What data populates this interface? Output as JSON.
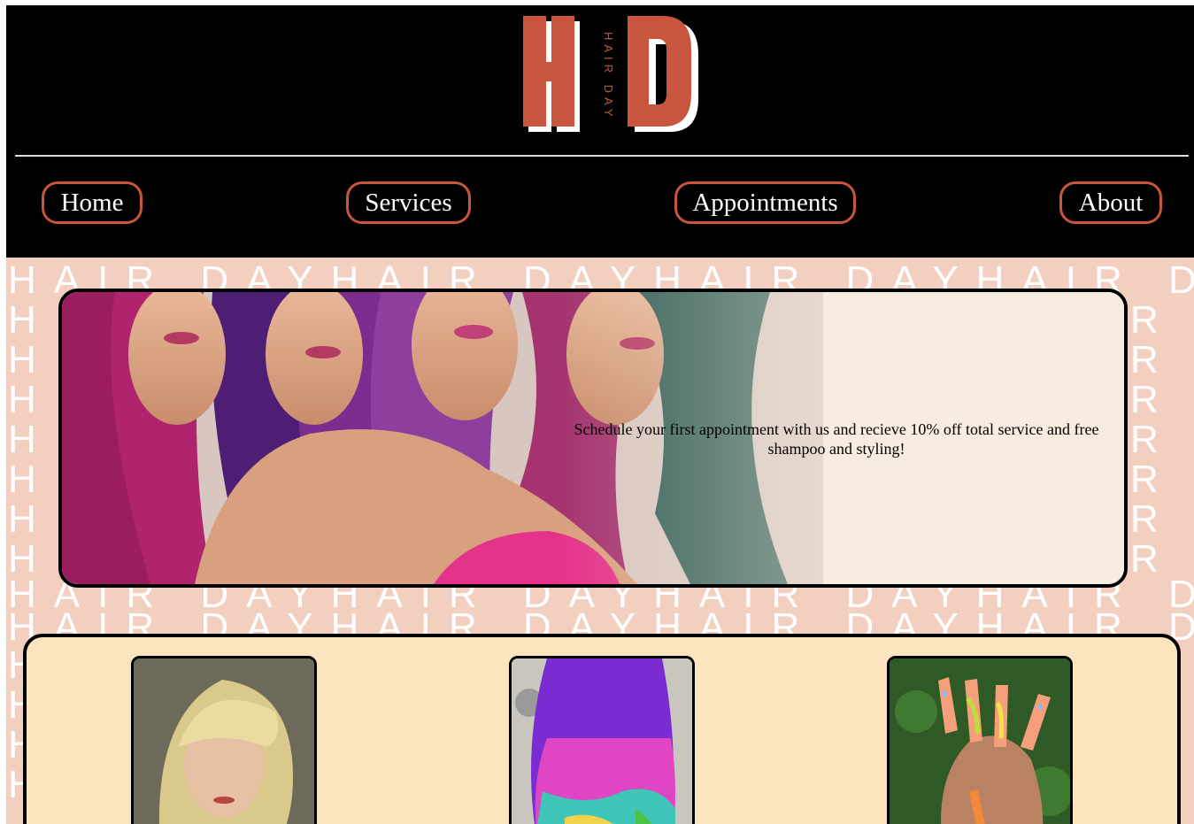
{
  "logo": {
    "letters_left": "H",
    "letters_right": "D",
    "tagline": "HAIR DAY",
    "brand_color": "#c8553d"
  },
  "nav": {
    "home": "Home",
    "services": "Services",
    "appointments": "Appointments",
    "about": "About"
  },
  "background_pattern": {
    "word": "HAIR DAY",
    "color": "#ffffff"
  },
  "banner": {
    "promo_text": "Schedule your first appointment with us and recieve 10% off total service and free shampoo and styling!"
  },
  "gallery": {
    "items": [
      {
        "icon": "blonde-short-hair-photo"
      },
      {
        "icon": "rainbow-hair-photo"
      },
      {
        "icon": "nail-art-photo"
      }
    ]
  },
  "colors": {
    "header_bg": "#000000",
    "accent": "#c8553d",
    "hero_bg": "#f3cfc0",
    "gallery_bg": "#fbe5bf"
  }
}
